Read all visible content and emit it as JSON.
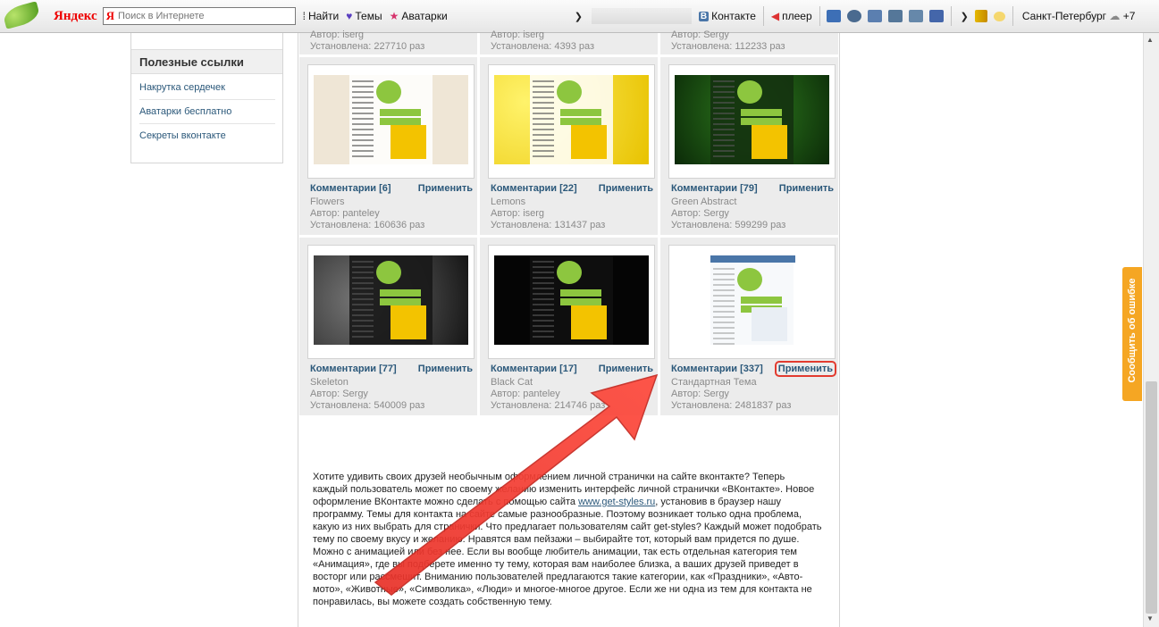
{
  "toolbar": {
    "brand": "Яндекс",
    "search_placeholder": "Поиск в Интернете",
    "find_label": "Найти",
    "themes_label": "Темы",
    "avatars_label": "Аватарки",
    "vk_badge": "B",
    "vk_label": "Контакте",
    "player_label": "плеер",
    "weather_city": "Санкт-Петербург",
    "weather_temp": "+7"
  },
  "sidebar": {
    "title": "Полезные ссылки",
    "links": [
      "Накрутка сердечек",
      "Аватарки бесплатно",
      "Секреты вконтакте"
    ]
  },
  "cards_top_partial": [
    {
      "author": "Автор: iserg",
      "installed": "Установлена: 227710 раз"
    },
    {
      "author": "Автор: iserg",
      "installed": "Установлена: 4393 раз"
    },
    {
      "author": "Автор: Sergy",
      "installed": "Установлена: 112233 раз"
    }
  ],
  "cards": [
    {
      "comments": "Комментарии [6]",
      "apply": "Применить",
      "name": "Flowers",
      "author": "Автор: panteley",
      "installed": "Установлена: 160636 раз",
      "bg": "#efe6d6",
      "accent": "#c0392b"
    },
    {
      "comments": "Комментарии [22]",
      "apply": "Применить",
      "name": "Lemons",
      "author": "Автор: iserg",
      "installed": "Установлена: 131437 раз",
      "bg": "#f2e23a",
      "accent": "#e8c200"
    },
    {
      "comments": "Комментарии [79]",
      "apply": "Применить",
      "name": "Green Abstract",
      "author": "Автор: Sergy",
      "installed": "Установлена: 599299 раз",
      "bg": "#133d0f",
      "accent": "#4caf30"
    },
    {
      "comments": "Комментарии [77]",
      "apply": "Применить",
      "name": "Skeleton",
      "author": "Автор: Sergy",
      "installed": "Установлена: 540009 раз",
      "bg": "#2a2a2a",
      "accent": "#777777"
    },
    {
      "comments": "Комментарии [17]",
      "apply": "Применить",
      "name": "Black Cat",
      "author": "Автор: panteley",
      "installed": "Установлена: 214746 раз",
      "bg": "#0b0b0b",
      "accent": "#333333"
    },
    {
      "comments": "Комментарии [337]",
      "apply": "Применить",
      "name": "Стандартная Тема",
      "author": "Автор: Sergy",
      "installed": "Установлена: 2481837 раз",
      "bg": "#ffffff",
      "accent": "#e8eef5"
    }
  ],
  "description": {
    "before_link": "Хотите удивить своих друзей необычным оформлением личной странички на сайте вконтакте? Теперь каждый пользователь может по своему желанию изменить интерфейс личной странички «ВКонтакте». Новое оформление ВКонтакте можно сделать с помощью сайта ",
    "link": "www.get-styles.ru",
    "after_link": ", установив в браузер нашу программу. Темы для контакта на сайте самые разнообразные. Поэтому возникает только одна проблема, какую из них выбрать для странички. Что предлагает пользователям сайт get-styles? Каждый может подобрать тему по своему вкусу и желанию. Нравятся вам пейзажи – выбирайте тот, который вам придется по душе. Можно с анимацией или без нее. Если вы вообще любитель анимации, так есть отдельная категория тем «Анимация», где вы подберете именно ту тему, которая вам наиболее близка, а ваших друзей приведет в восторг или рассмешит. Вниманию пользователей предлагаются такие категории, как «Праздники», «Авто-мото», «Животные», «Символика», «Люди» и многое-многое другое. Если же ни одна из тем для контакта не понравилась, вы можете создать собственную тему."
  },
  "feedback_tab": "Сообщить об ошибке",
  "colors": {
    "link": "#2b587a",
    "highlight": "#e23b2f",
    "feedback": "#f5a623"
  }
}
